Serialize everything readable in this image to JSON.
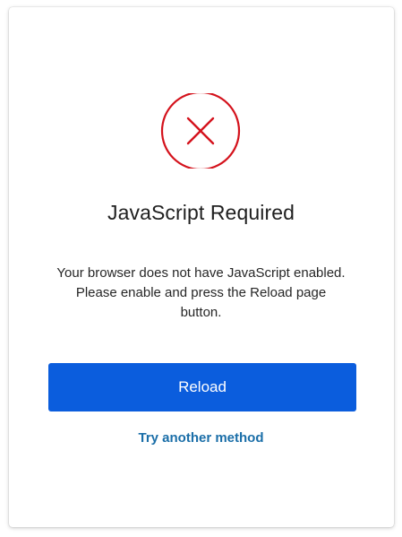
{
  "dialog": {
    "icon": "error-x-circle-icon",
    "title": "JavaScript Required",
    "message": "Your browser does not have JavaScript enabled. Please enable and press the Reload page button.",
    "reload_label": "Reload",
    "alt_method_label": "Try another method"
  },
  "colors": {
    "error_red": "#d4121c",
    "primary_button": "#0b5ddd",
    "link_blue": "#1a6ea8"
  }
}
